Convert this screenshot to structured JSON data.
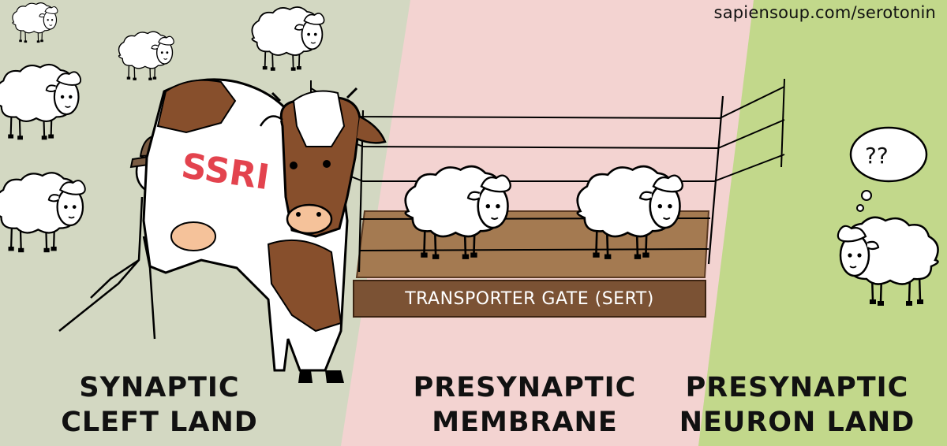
{
  "source": "sapiensoup.com/serotonin",
  "regions": [
    {
      "line1": "SYNAPTIC",
      "line2": "CLEFT LAND"
    },
    {
      "line1": "PRESYNAPTIC",
      "line2": "MEMBRANE"
    },
    {
      "line1": "PRESYNAPTIC",
      "line2": "NEURON LAND"
    }
  ],
  "gate_label": "TRANSPORTER GATE (SERT)",
  "cow_label": "SSRI",
  "thought": "??",
  "colors": {
    "cleft_bg": "#d3d8c2",
    "membrane_bg": "#f3d3d1",
    "neuron_bg": "#c2d88b",
    "gate_floor": "#a47a51",
    "gate_sign": "#7b5234",
    "ssri_text": "#e3434e",
    "cow_brown": "#874f2c",
    "udder": "#f5c29a"
  }
}
